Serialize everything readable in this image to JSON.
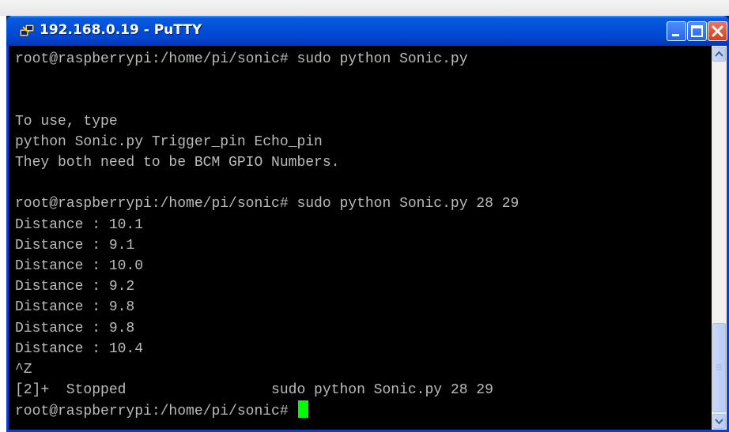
{
  "window": {
    "title": "192.168.0.19 - PuTTY",
    "icon": "putty-icon",
    "buttons": [
      "minimize-icon",
      "maximize-icon",
      "close-icon"
    ]
  },
  "terminal": {
    "lines": [
      "root@raspberrypi:/home/pi/sonic# sudo python Sonic.py",
      "",
      "",
      "To use, type",
      "python Sonic.py Trigger_pin Echo_pin",
      "They both need to be BCM GPIO Numbers.",
      "",
      "root@raspberrypi:/home/pi/sonic# sudo python Sonic.py 28 29",
      "Distance : 10.1",
      "Distance : 9.1",
      "Distance : 10.0",
      "Distance : 9.2",
      "Distance : 9.8",
      "Distance : 9.8",
      "Distance : 10.4",
      "^Z",
      "[2]+  Stopped                 sudo python Sonic.py 28 29",
      "root@raspberrypi:/home/pi/sonic# "
    ],
    "cursor_color": "#00ff00",
    "text_color": "#bbbbbb",
    "background": "#000000"
  },
  "colors": {
    "titlebar": "#0250d8",
    "frame": "#0a3fd0",
    "close_button": "#d2401e"
  }
}
